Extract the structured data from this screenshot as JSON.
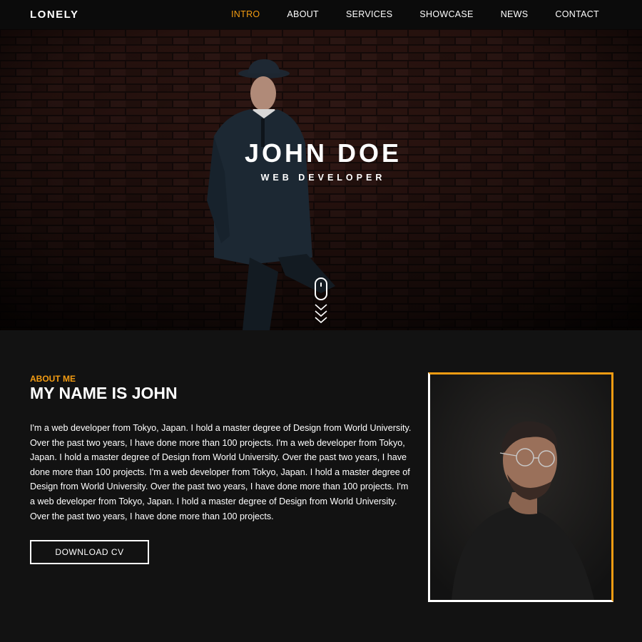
{
  "brand": {
    "logo": "LONELY",
    "accent": "#f39c12"
  },
  "nav": {
    "items": [
      {
        "label": "INTRO",
        "active": true
      },
      {
        "label": "ABOUT",
        "active": false
      },
      {
        "label": "SERVICES",
        "active": false
      },
      {
        "label": "SHOWCASE",
        "active": false
      },
      {
        "label": "NEWS",
        "active": false
      },
      {
        "label": "CONTACT",
        "active": false
      }
    ]
  },
  "hero": {
    "name": "JOHN DOE",
    "role": "WEB DEVELOPER",
    "scroll_icon": "mouse-scroll-icon",
    "arrows_icon": "chevron-down-icon"
  },
  "about": {
    "tag": "ABOUT ME",
    "heading": "MY NAME IS JOHN",
    "body": "I'm a web developer from Tokyo, Japan. I hold a master degree of Design from World University. Over the past two years, I have done more than 100 projects. I'm a web developer from Tokyo, Japan. I hold a master degree of Design from World University. Over the past two years, I have done more than 100 projects. I'm a web developer from Tokyo, Japan. I hold a master degree of Design from World University. Over the past two years, I have done more than 100 projects. I'm a web developer from Tokyo, Japan. I hold a master degree of Design from World University. Over the past two years, I have done more than 100 projects.",
    "button": "DOWNLOAD CV"
  }
}
